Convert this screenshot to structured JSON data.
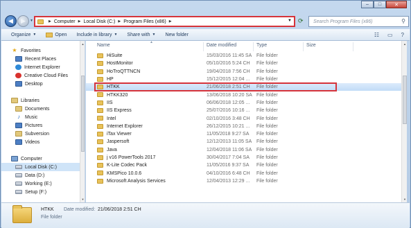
{
  "window": {
    "caption_buttons": [
      "–",
      "□",
      "✕"
    ]
  },
  "address": {
    "crumbs": [
      "Computer",
      "Local Disk (C:)",
      "Program Files (x86)"
    ],
    "search_placeholder": "Search Program Files (x86)"
  },
  "toolbar": {
    "organize": "Organize",
    "open": "Open",
    "include_in_library": "Include in library",
    "share_with": "Share with",
    "new_folder": "New folder"
  },
  "nav": {
    "favorites_head": "Favorites",
    "favorites": [
      "Recent Places",
      "Internet Explorer",
      "Creative Cloud Files",
      "Desktop"
    ],
    "libraries_head": "Libraries",
    "libraries": [
      "Documents",
      "Music",
      "Pictures",
      "Subversion",
      "Videos"
    ],
    "computer_head": "Computer",
    "drives": [
      "Local Disk (C:)",
      "Data (D:)",
      "Working (E:)",
      "Setup (F:)"
    ]
  },
  "columns": {
    "name": "Name",
    "date_modified": "Date modified",
    "type": "Type",
    "size": "Size"
  },
  "files": [
    {
      "name": "HiSuite",
      "date": "15/03/2016 11:45 SA",
      "type": "File folder"
    },
    {
      "name": "HostMonitor",
      "date": "05/10/2016 5:24 CH",
      "type": "File folder"
    },
    {
      "name": "HoTroQTTNCN",
      "date": "19/04/2018 7:56 CH",
      "type": "File folder"
    },
    {
      "name": "HP",
      "date": "15/12/2015 12:04 ...",
      "type": "File folder"
    },
    {
      "name": "HTKK",
      "date": "21/06/2018 2:51 CH",
      "type": "File folder"
    },
    {
      "name": "HTKK320",
      "date": "13/06/2018 10:20 SA",
      "type": "File folder"
    },
    {
      "name": "IIS",
      "date": "06/06/2018 12:05 ...",
      "type": "File folder"
    },
    {
      "name": "IIS Express",
      "date": "25/07/2016 10:16 ...",
      "type": "File folder"
    },
    {
      "name": "Intel",
      "date": "02/10/2016 3:48 CH",
      "type": "File folder"
    },
    {
      "name": "Internet Explorer",
      "date": "26/12/2015 10:21 ...",
      "type": "File folder"
    },
    {
      "name": "iTax Viewer",
      "date": "11/05/2018 9:27 SA",
      "type": "File folder"
    },
    {
      "name": "Jaspersoft",
      "date": "12/12/2013 11:05 SA",
      "type": "File folder"
    },
    {
      "name": "Java",
      "date": "12/04/2018 11:06 SA",
      "type": "File folder"
    },
    {
      "name": "j v16 PowerTools 2017",
      "date": "30/04/2017 7:04 SA",
      "type": "File folder"
    },
    {
      "name": "K-Lite Codec Pack",
      "date": "11/05/2016 9:37 SA",
      "type": "File folder"
    },
    {
      "name": "KMSPico 10.0.6",
      "date": "04/10/2016 6:48 CH",
      "type": "File folder"
    },
    {
      "name": "Microsoft Analysis Services",
      "date": "12/04/2013 12:29 ...",
      "type": "File folder"
    }
  ],
  "selected_index": 4,
  "details": {
    "name": "HTKK",
    "modified_label": "Date modified:",
    "modified_value": "21/06/2018 2:51 CH",
    "type": "File folder"
  }
}
